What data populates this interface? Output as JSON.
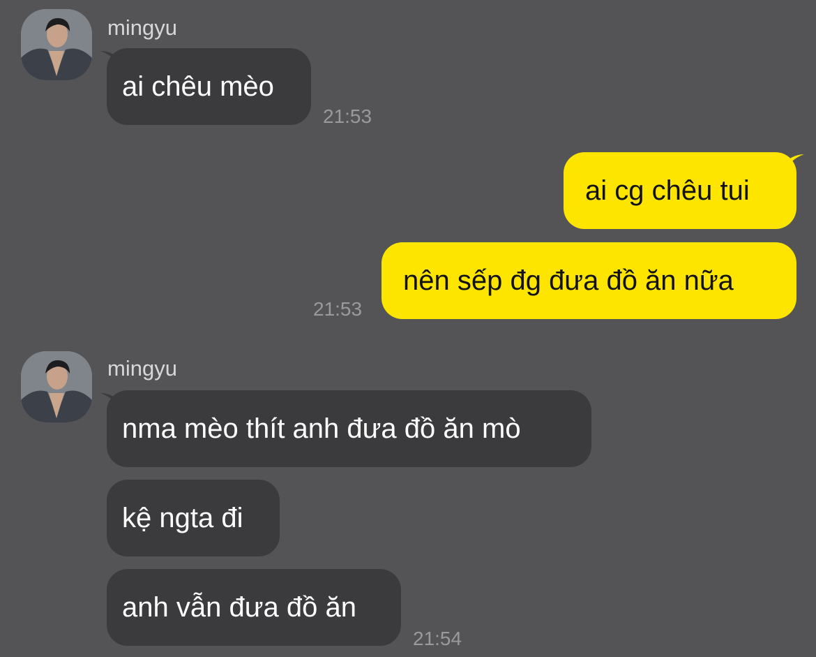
{
  "chat": {
    "groups": [
      {
        "sender": "mingyu",
        "messages": [
          {
            "text": "ai chêu mèo"
          }
        ],
        "time": "21:53"
      },
      {
        "sender": "me",
        "messages": [
          {
            "text": "ai cg chêu tui"
          },
          {
            "text": "nên sếp đg đưa đồ ăn nữa"
          }
        ],
        "time": "21:53"
      },
      {
        "sender": "mingyu",
        "messages": [
          {
            "text": "nma mèo thít anh đưa đồ ăn mò"
          },
          {
            "text": "kệ ngta đi"
          },
          {
            "text": "anh vẫn đưa đồ ăn"
          }
        ],
        "time": "21:54"
      }
    ]
  },
  "colors": {
    "background": "#545355",
    "incoming_bubble": "#3b3a3d",
    "outgoing_bubble": "#fee500",
    "timestamp": "#9a999c"
  },
  "icons": {
    "avatar": "profile-photo"
  }
}
